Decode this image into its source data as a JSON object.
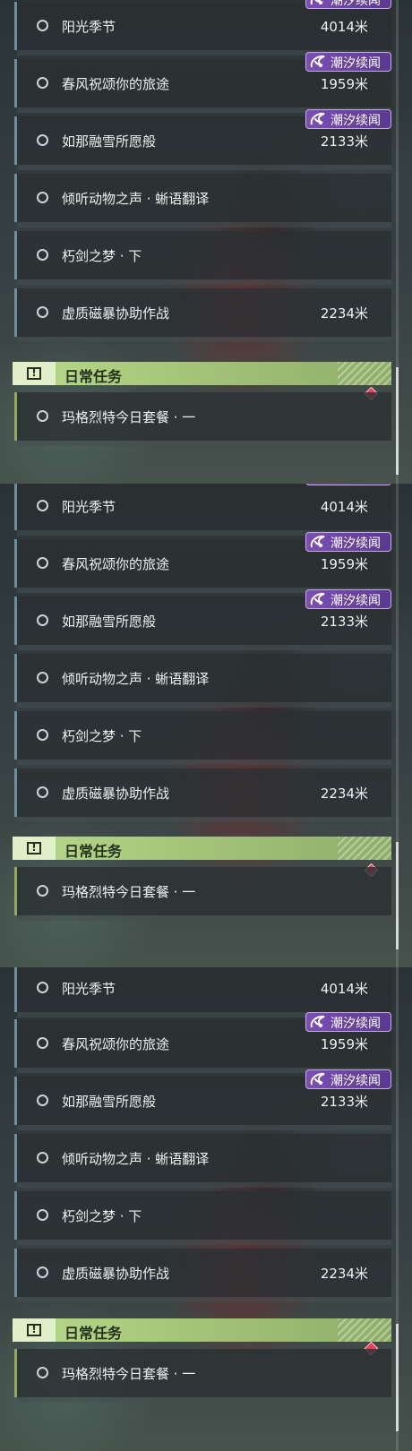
{
  "panels": [
    {
      "quests": [
        {
          "name": "阳光季节",
          "distance": "4014米",
          "badge": true
        },
        {
          "name": "春风祝颂你的旅途",
          "distance": "1959米",
          "badge": true
        },
        {
          "name": "如那融雪所愿般",
          "distance": "2133米",
          "badge": true
        },
        {
          "name": "倾听动物之声 · 蜥语翻译",
          "distance": ""
        },
        {
          "name": "朽剑之梦 · 下",
          "distance": ""
        },
        {
          "name": "虚质磁暴协助作战",
          "distance": "2234米"
        }
      ],
      "section": {
        "title": "日常任务"
      },
      "daily": {
        "name": "玛格烈特今日套餐 · 一"
      }
    },
    {
      "quests": [
        {
          "name": "阳光季节",
          "distance": "4014米",
          "badge": true
        },
        {
          "name": "春风祝颂你的旅途",
          "distance": "1959米",
          "badge": true
        },
        {
          "name": "如那融雪所愿般",
          "distance": "2133米",
          "badge": true
        },
        {
          "name": "倾听动物之声 · 蜥语翻译",
          "distance": ""
        },
        {
          "name": "朽剑之梦 · 下",
          "distance": ""
        },
        {
          "name": "虚质磁暴协助作战",
          "distance": "2234米"
        }
      ],
      "section": {
        "title": "日常任务"
      },
      "daily": {
        "name": "玛格烈特今日套餐 · 一"
      }
    },
    {
      "quests": [
        {
          "name": "阳光季节",
          "distance": "4014米",
          "badge": false
        },
        {
          "name": "春风祝颂你的旅途",
          "distance": "1959米",
          "badge": true
        },
        {
          "name": "如那融雪所愿般",
          "distance": "2133米",
          "badge": true
        },
        {
          "name": "倾听动物之声 · 蜥语翻译",
          "distance": ""
        },
        {
          "name": "朽剑之梦 · 下",
          "distance": ""
        },
        {
          "name": "虚质磁暴协助作战",
          "distance": "2234米"
        }
      ],
      "section": {
        "title": "日常任务"
      },
      "daily": {
        "name": "玛格烈特今日套餐 · 一"
      }
    }
  ],
  "badge_label": "潮汐续闻",
  "icons": {
    "badge": "tide-swirl-icon",
    "alert": "exclamation-icon",
    "marker": "red-diamond-icon"
  },
  "colors": {
    "badge_bg": "#7b4fb3",
    "section_bg": "#b8d88a",
    "marker": "#e0455a"
  }
}
